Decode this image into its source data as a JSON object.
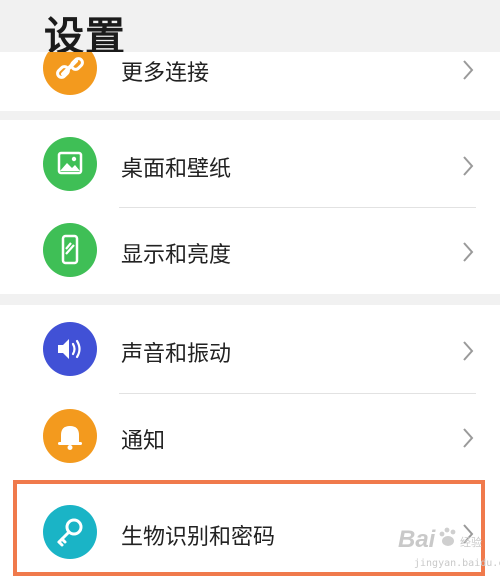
{
  "header": {
    "title": "设置"
  },
  "settings": [
    {
      "label": "更多连接",
      "icon": "link-icon",
      "color": "#f39a1e"
    },
    {
      "label": "桌面和壁纸",
      "icon": "image-icon",
      "color": "#3fbf56"
    },
    {
      "label": "显示和亮度",
      "icon": "phone-brightness-icon",
      "color": "#3fbf56"
    },
    {
      "label": "声音和振动",
      "icon": "speaker-icon",
      "color": "#4151d6"
    },
    {
      "label": "通知",
      "icon": "bell-icon",
      "color": "#f39a1e"
    },
    {
      "label": "生物识别和密码",
      "icon": "key-icon",
      "color": "#1ab4c6"
    }
  ],
  "highlight": {
    "target": "生物识别和密码",
    "color": "#f07a4c"
  },
  "watermark": {
    "brand": "Bai",
    "sub": "经验",
    "url": "jingyan.baidu.com"
  }
}
